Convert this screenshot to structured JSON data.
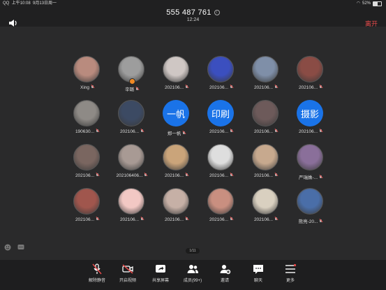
{
  "status": {
    "carrier": "QQ",
    "time": "上午10:08",
    "date": "9月13日周一",
    "battery": "52%",
    "battery_level": 0.52
  },
  "meeting": {
    "id": "555 487 761",
    "duration": "12:24",
    "leave_label": "离开"
  },
  "participants": [
    {
      "name": "Xing",
      "avatar": "photo",
      "color": "#b98b7e",
      "host": false
    },
    {
      "name": "辛璐",
      "avatar": "photo",
      "color": "#9d9d9d",
      "host": true
    },
    {
      "name": "202106...",
      "avatar": "photo",
      "color": "#cfc7c4"
    },
    {
      "name": "202106...",
      "avatar": "photo",
      "color": "#3b4fbf"
    },
    {
      "name": "202106...",
      "avatar": "photo",
      "color": "#7f8fa8"
    },
    {
      "name": "202106...",
      "avatar": "photo",
      "color": "#8a4c45"
    },
    {
      "name": "190630...",
      "avatar": "photo",
      "color": "#8e8a86"
    },
    {
      "name": "202106...",
      "avatar": "photo",
      "color": "#3c4a63"
    },
    {
      "name": "郑一帆",
      "avatar": "text",
      "text": "一帆"
    },
    {
      "name": "202106...",
      "avatar": "text",
      "text": "印刷"
    },
    {
      "name": "202106...",
      "avatar": "photo",
      "color": "#6d5a5a"
    },
    {
      "name": "202106...",
      "avatar": "text",
      "text": "摄影"
    },
    {
      "name": "202106...",
      "avatar": "photo",
      "color": "#7a6660"
    },
    {
      "name": "202106406...",
      "avatar": "photo",
      "color": "#a89a94"
    },
    {
      "name": "202106...",
      "avatar": "photo",
      "color": "#caa47a"
    },
    {
      "name": "202106...",
      "avatar": "photo",
      "color": "#dedede"
    },
    {
      "name": "202106...",
      "avatar": "photo",
      "color": "#c7a98e"
    },
    {
      "name": "严瑞姝-...",
      "avatar": "photo",
      "color": "#8a6f9a"
    },
    {
      "name": "202106...",
      "avatar": "photo",
      "color": "#a0564d"
    },
    {
      "name": "202106...",
      "avatar": "photo",
      "color": "#f2c8c4"
    },
    {
      "name": "202106...",
      "avatar": "photo",
      "color": "#c6b0a6"
    },
    {
      "name": "202106...",
      "avatar": "photo",
      "color": "#c98f80"
    },
    {
      "name": "202106...",
      "avatar": "photo",
      "color": "#d9d0c0"
    },
    {
      "name": "熊亮-20...",
      "avatar": "photo",
      "color": "#4a6ea8"
    }
  ],
  "pager": "1/11",
  "toolbar": [
    {
      "label": "解除静音",
      "icon": "muted-mic-icon"
    },
    {
      "label": "开启视频",
      "icon": "video-off-icon"
    },
    {
      "label": "共享屏幕",
      "icon": "share-screen-icon"
    },
    {
      "label": "成员(99+)",
      "icon": "members-icon"
    },
    {
      "label": "邀请",
      "icon": "invite-icon"
    },
    {
      "label": "聊天",
      "icon": "chat-icon"
    },
    {
      "label": "更多",
      "icon": "more-icon"
    }
  ]
}
